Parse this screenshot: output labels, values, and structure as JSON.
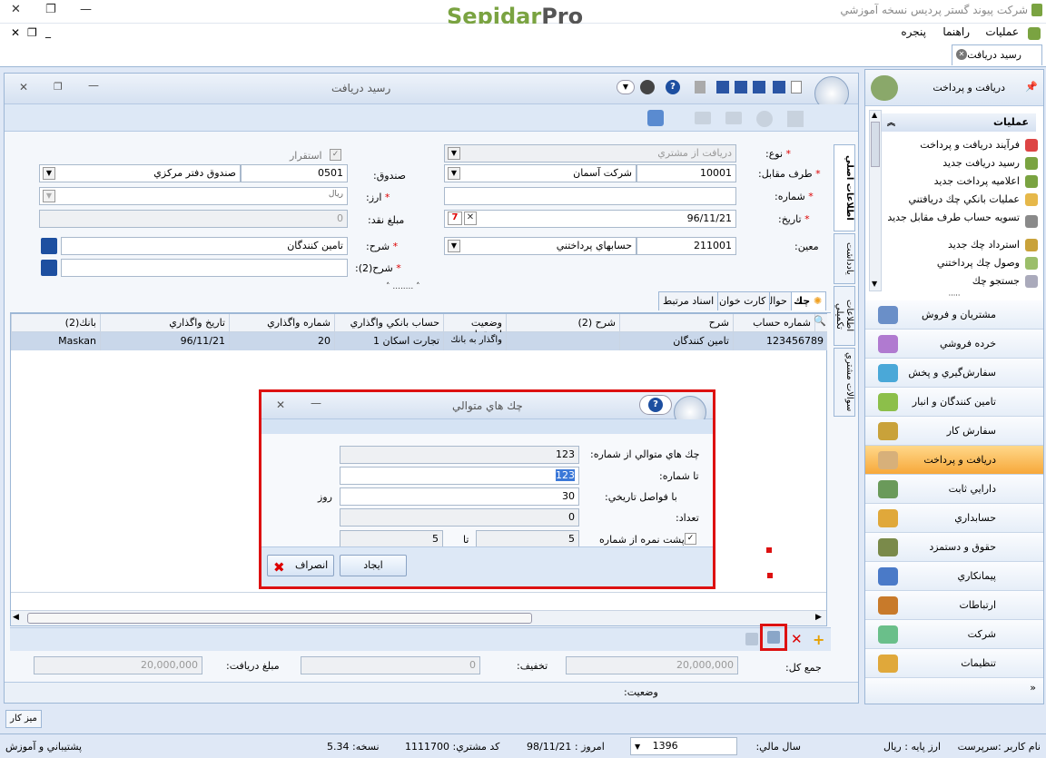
{
  "app": {
    "title": "شرکت پیوند گستر پردیس نسخه آموزشي",
    "logo_a": "Sepidar",
    "logo_b": "Pro"
  },
  "menu": {
    "items": [
      "عملیات",
      "راهنما",
      "پنجره"
    ]
  },
  "doc_tab": "رسيد دريافت",
  "form": {
    "title": "رسيد دريافت",
    "type_label": "نوع:",
    "type_value": "دريافت از مشتري",
    "counterparty_label": "طرف مقابل:",
    "counterparty_code": "10001",
    "counterparty_name": "شرکت آسمان",
    "number_label": "شماره:",
    "number_value": "",
    "date_label": "تاريخ:",
    "date_value": "96/11/21",
    "account_label": "معين:",
    "account_code": "211001",
    "account_name": "حسابهاي پرداختني",
    "settle_label": "استقرار",
    "box_label": "صندوق:",
    "box_code": "0501",
    "box_name": "صندوق دفتر مرکزي",
    "currency_label": "ارز:",
    "currency_value": "ريال",
    "cash_label": "مبلغ نقد:",
    "cash_value": "0",
    "desc_label": "شرح:",
    "desc_value": "تامين كنندگان",
    "desc2_label": "شرح(2):",
    "desc2_value": ""
  },
  "side_tabs": [
    "اطلاعات اصلي",
    "يادداشت",
    "اطلاعات تكميلي",
    "سوالات مشتري"
  ],
  "sub_tabs": [
    "چك",
    "حواله",
    "كارت خوان",
    "اسناد مرتبط"
  ],
  "grid": {
    "headers": [
      "شماره حساب",
      "شرح",
      "شرح (2)",
      "وضعيت استقرار",
      "حساب بانكي واگذاري",
      "شماره واگذاري",
      "تاريخ واگذاري",
      "بانك(2)"
    ],
    "row": [
      "123456789",
      "تامين كنندگان",
      "",
      "واگذار به بانك",
      "تجارت اسكان 1",
      "20",
      "96/11/21",
      "Maskan"
    ]
  },
  "dialog": {
    "title": "چك هاي متوالي",
    "from_label": "چك هاي متوالي از شماره:",
    "from_value": "123",
    "to_label": "تا شماره:",
    "to_value": "123",
    "interval_label": "با فواصل تاريخي:",
    "interval_value": "30",
    "day_unit": "روز",
    "count_label": "تعداد:",
    "count_value": "0",
    "back_label": "پشت نمره از شماره",
    "back_from": "5",
    "back_to_label": "تا",
    "back_to": "5",
    "create_btn": "ايجاد",
    "cancel_btn": "انصراف"
  },
  "totals": {
    "total_label": "جمع كل:",
    "total_value": "20,000,000",
    "discount_label": "تخفيف:",
    "discount_value": "0",
    "received_label": "مبلغ دريافت:",
    "received_value": "20,000,000",
    "status_label": "وضعيت:"
  },
  "right_panel": {
    "title": "دريافت و پرداخت",
    "ops_title": "عمليات",
    "ops": [
      "فرآيند دريافت و پرداخت",
      "رسيد دريافت جديد",
      "اعلاميه پرداخت جديد",
      "عمليات بانكي چك دريافتني",
      "تسويه حساب طرف مقابل جديد",
      "استرداد چك جديد",
      "وصول چك پرداختني",
      "جستجو چك"
    ],
    "modules": [
      "مشتريان و فروش",
      "خرده فروشي",
      "سفارش‌گيري و پخش",
      "تامين كنندگان و انبار",
      "سفارش كار",
      "دريافت و پرداخت",
      "دارايي ثابت",
      "حسابداري",
      "حقوق و دستمزد",
      "پيمانكاري",
      "ارتباطات",
      "شركت",
      "تنظيمات"
    ],
    "active_module_index": 5
  },
  "desktop_btn": "ميز كار",
  "status": {
    "user": "نام كاربر :سرپرست",
    "base_currency": "ارز پايه : ريال",
    "fiscal_year_label": "سال مالي:",
    "fiscal_year": "1396",
    "today": "امروز : 98/11/21",
    "customer_code": "كد مشتري: 1111700",
    "version": "نسخه: 5.34",
    "support": "پشتيباني و آموزش"
  },
  "colors": {
    "accent": "#f7a83a",
    "frame": "#9db7d6",
    "highlight": "#dd1111"
  }
}
